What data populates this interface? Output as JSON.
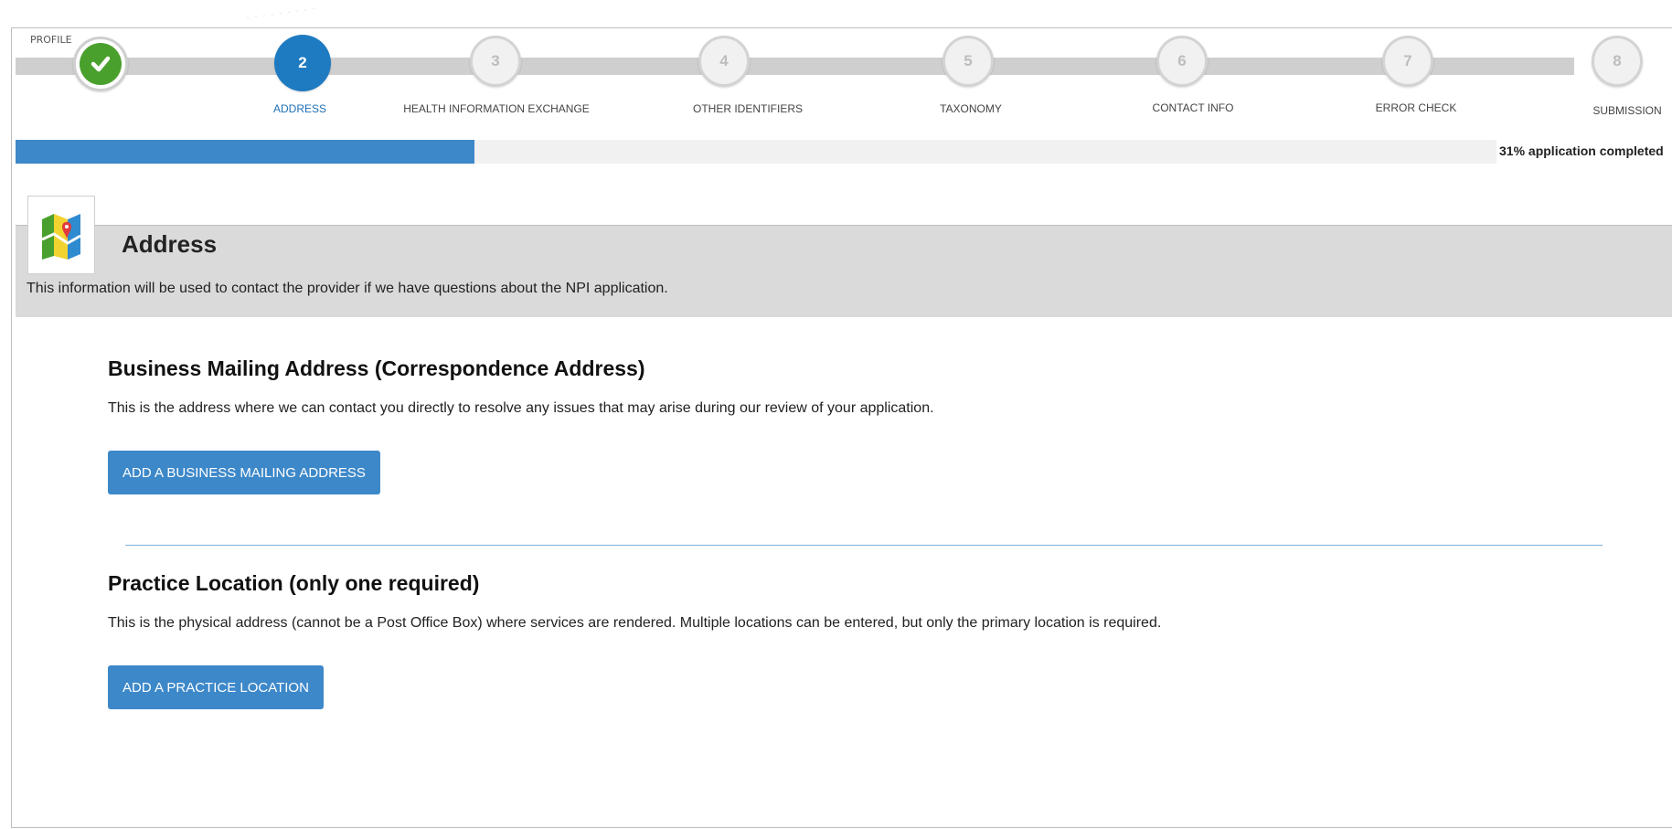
{
  "stepper": {
    "profile_label": "PROFILE",
    "steps": [
      {
        "number": "2",
        "label": "ADDRESS",
        "state": "active"
      },
      {
        "number": "3",
        "label": "HEALTH INFORMATION EXCHANGE",
        "state": "pending"
      },
      {
        "number": "4",
        "label": "OTHER IDENTIFIERS",
        "state": "pending"
      },
      {
        "number": "5",
        "label": "TAXONOMY",
        "state": "pending"
      },
      {
        "number": "6",
        "label": "CONTACT INFO",
        "state": "pending"
      },
      {
        "number": "7",
        "label": "ERROR CHECK",
        "state": "pending"
      },
      {
        "number": "8",
        "label": "SUBMISSION",
        "state": "pending"
      }
    ],
    "completed_icon": "checkmark-icon"
  },
  "progress": {
    "percent": 31,
    "text": "31% application completed"
  },
  "section": {
    "icon": "map-icon",
    "title": "Address",
    "description": "This information will be used to contact the provider if we have questions about the NPI application."
  },
  "mailing": {
    "title": "Business Mailing Address (Correspondence Address)",
    "description": "This is the address where we can contact you directly to resolve any issues that may arise during our review of your application.",
    "button_label": "ADD A BUSINESS MAILING ADDRESS"
  },
  "practice": {
    "title": "Practice Location (only one required)",
    "description": "This is the physical address (cannot be a Post Office Box) where services are rendered. Multiple locations can be entered, but only the primary location is required.",
    "button_label": "ADD A PRACTICE LOCATION"
  },
  "colors": {
    "accent": "#3d88c9",
    "active_step": "#1f7bc1",
    "completed_step": "#4aa02c",
    "header_bg": "#dadada"
  }
}
